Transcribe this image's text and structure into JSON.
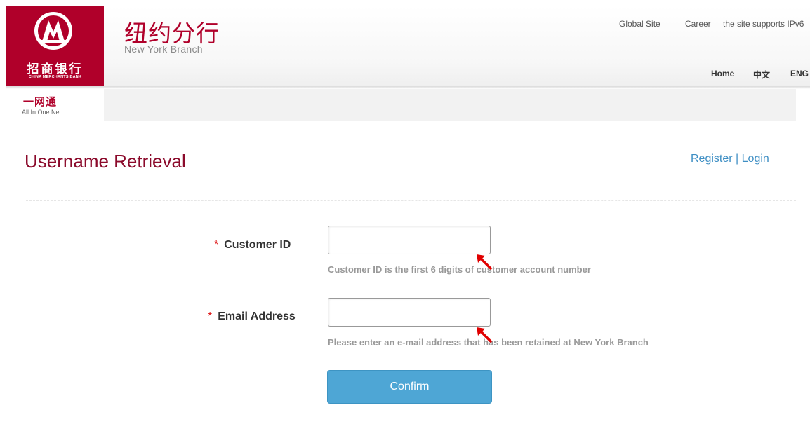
{
  "header": {
    "logo_cn": "招商银行",
    "logo_en": "CHINA MERCHANTS BANK",
    "brand_cn": "纽约分行",
    "brand_en": "New York Branch",
    "top_links": [
      "Global Site",
      "Career",
      "the site supports IPv6"
    ],
    "nav": [
      "Home",
      "中文",
      "ENG"
    ]
  },
  "subnav": {
    "cn": "一网通",
    "en": "All In One Net"
  },
  "page": {
    "title": "Username Retrieval",
    "register_label": "Register",
    "separator": "|",
    "login_label": "Login"
  },
  "form": {
    "customer_id": {
      "label": "Customer ID",
      "required_mark": "*",
      "value": "",
      "hint": "Customer ID is the first 6 digits of customer account number"
    },
    "email": {
      "label": "Email Address",
      "required_mark": "*",
      "value": "",
      "hint": "Please enter an e-mail address that has been retained at New York Branch"
    },
    "confirm_label": "Confirm"
  },
  "colors": {
    "brand_red": "#b0002a",
    "button_blue": "#4ea6d5",
    "link_blue": "#3f8fc4"
  }
}
